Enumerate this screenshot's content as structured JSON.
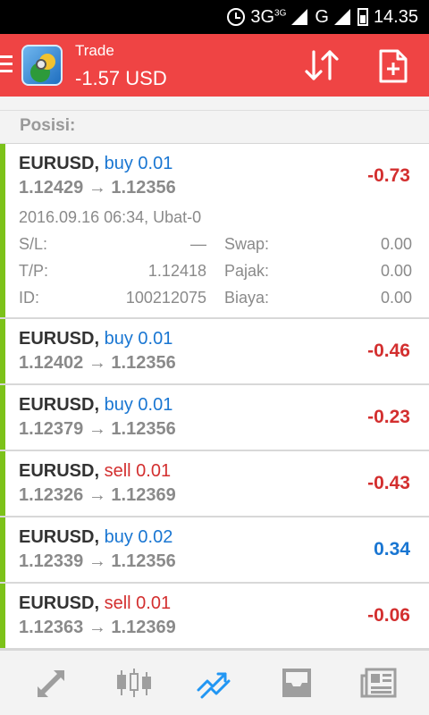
{
  "status_bar": {
    "network_3g": "3G",
    "network_3g_sup": "3G",
    "network_g": "G",
    "time": "14.35"
  },
  "app_bar": {
    "title": "Trade",
    "balance": "-1.57 USD"
  },
  "section": {
    "title": "Posisi:"
  },
  "positions": [
    {
      "symbol": "EURUSD,",
      "side": "buy",
      "volume": "0.01",
      "open_price": "1.12429",
      "arrow": "→",
      "current_price": "1.12356",
      "profit": "-0.73",
      "expanded": true,
      "timestamp": "2016.09.16 06:34, Ubat-0",
      "details": [
        {
          "label": "S/L:",
          "value": "—",
          "label2": "Swap:",
          "value2": "0.00"
        },
        {
          "label": "T/P:",
          "value": "1.12418",
          "label2": "Pajak:",
          "value2": "0.00"
        },
        {
          "label": "ID:",
          "value": "100212075",
          "label2": "Biaya:",
          "value2": "0.00"
        }
      ]
    },
    {
      "symbol": "EURUSD,",
      "side": "buy",
      "volume": "0.01",
      "open_price": "1.12402",
      "arrow": "→",
      "current_price": "1.12356",
      "profit": "-0.46"
    },
    {
      "symbol": "EURUSD,",
      "side": "buy",
      "volume": "0.01",
      "open_price": "1.12379",
      "arrow": "→",
      "current_price": "1.12356",
      "profit": "-0.23"
    },
    {
      "symbol": "EURUSD,",
      "side": "sell",
      "volume": "0.01",
      "open_price": "1.12326",
      "arrow": "→",
      "current_price": "1.12369",
      "profit": "-0.43"
    },
    {
      "symbol": "EURUSD,",
      "side": "buy",
      "volume": "0.02",
      "open_price": "1.12339",
      "arrow": "→",
      "current_price": "1.12356",
      "profit": "0.34"
    },
    {
      "symbol": "EURUSD,",
      "side": "sell",
      "volume": "0.01",
      "open_price": "1.12363",
      "arrow": "→",
      "current_price": "1.12369",
      "profit": "-0.06"
    }
  ],
  "bottom_nav": [
    {
      "icon": "quotes-icon",
      "active": false
    },
    {
      "icon": "chart-icon",
      "active": false
    },
    {
      "icon": "trade-icon",
      "active": true
    },
    {
      "icon": "history-icon",
      "active": false
    },
    {
      "icon": "news-icon",
      "active": false
    }
  ],
  "colors": {
    "app_bar": "#ef4444",
    "buy": "#1976d2",
    "sell": "#d32f2f",
    "profit_negative": "#d32f2f",
    "profit_positive": "#1976d2",
    "position_bar": "#7cc219",
    "nav_active": "#2196f3",
    "nav_inactive": "#9e9e9e"
  }
}
